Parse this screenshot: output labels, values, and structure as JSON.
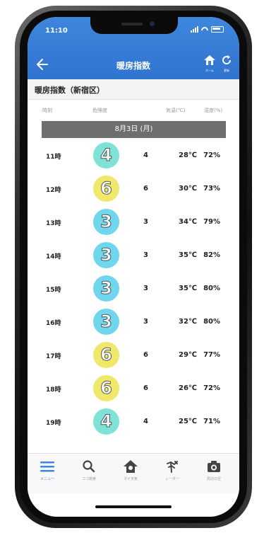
{
  "status": {
    "time": "11:10"
  },
  "nav": {
    "title": "暖房指数",
    "home_label": "ホーム",
    "refresh_label": "更新"
  },
  "subheading": "暖房指数（新宿区）",
  "columns": {
    "time": "時刻",
    "risk": "危険度",
    "temp": "気温(℃)",
    "humidity": "湿度(%)"
  },
  "date": "8月3日 (月)",
  "rows": [
    {
      "hour": "11時",
      "badge": "4",
      "level": "4",
      "temp": "28℃",
      "humidity": "72%"
    },
    {
      "hour": "12時",
      "badge": "6",
      "level": "6",
      "temp": "30℃",
      "humidity": "73%"
    },
    {
      "hour": "13時",
      "badge": "3",
      "level": "3",
      "temp": "34℃",
      "humidity": "79%"
    },
    {
      "hour": "14時",
      "badge": "3",
      "level": "3",
      "temp": "35℃",
      "humidity": "82%"
    },
    {
      "hour": "15時",
      "badge": "3",
      "level": "3",
      "temp": "35℃",
      "humidity": "80%"
    },
    {
      "hour": "16時",
      "badge": "3",
      "level": "3",
      "temp": "32℃",
      "humidity": "80%"
    },
    {
      "hour": "17時",
      "badge": "6",
      "level": "6",
      "temp": "29℃",
      "humidity": "77%"
    },
    {
      "hour": "18時",
      "badge": "6",
      "level": "6",
      "temp": "26℃",
      "humidity": "72%"
    },
    {
      "hour": "19時",
      "badge": "4",
      "level": "4",
      "temp": "25℃",
      "humidity": "71%"
    }
  ],
  "badge_colors": {
    "3": "#6fd6ee",
    "4": "#7ee2d6",
    "6": "#efe86a"
  },
  "tabs": [
    {
      "label": "メニュー",
      "icon": "menu-icon"
    },
    {
      "label": "ココ検索",
      "icon": "search-icon"
    },
    {
      "label": "マイ天気",
      "icon": "house-icon"
    },
    {
      "label": "レーダー",
      "icon": "radar-icon"
    },
    {
      "label": "周辺の空",
      "icon": "camera-icon"
    }
  ],
  "colors": {
    "header": "#3f86de",
    "accent": "#3f86de"
  }
}
